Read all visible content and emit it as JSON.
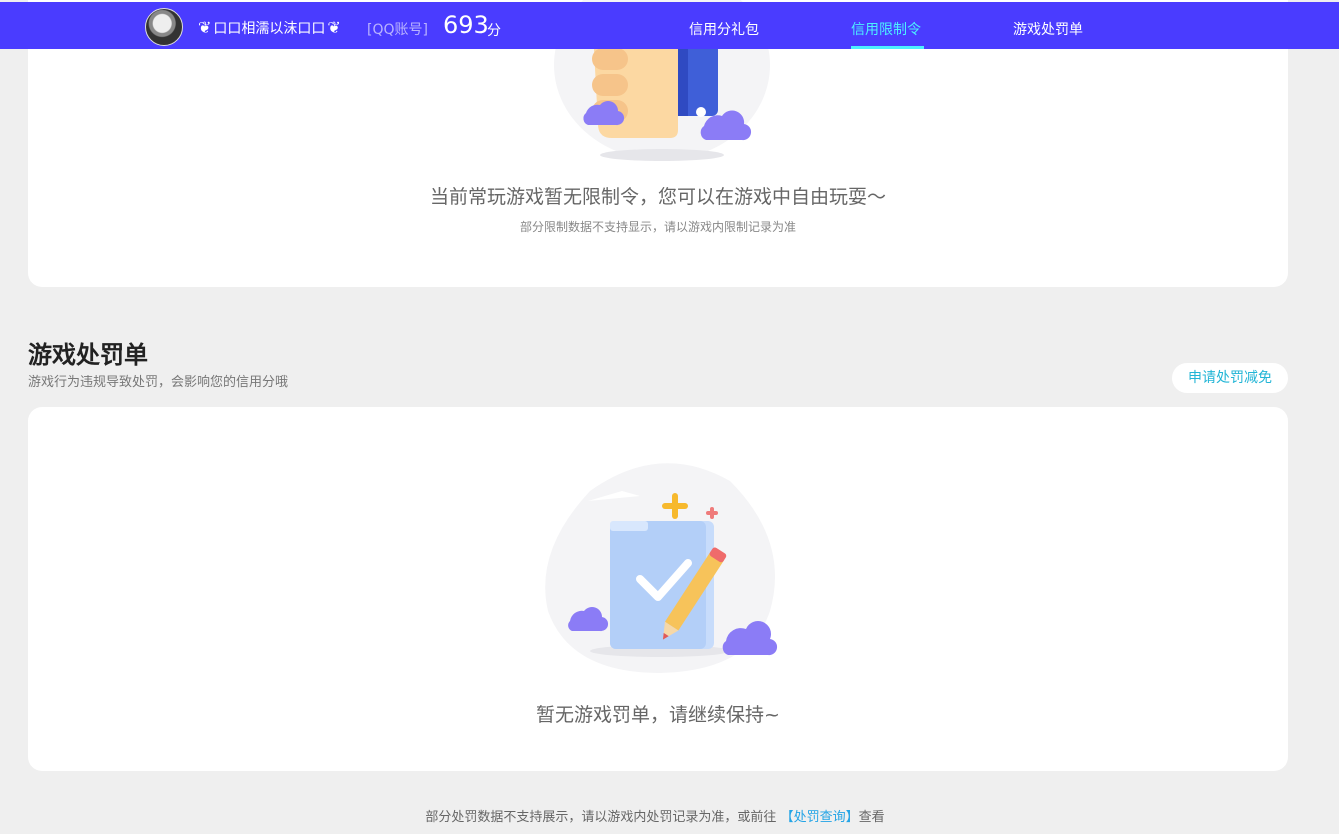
{
  "header": {
    "nickname": "口口相濡以沫口口",
    "nick_swirl_left": "ڿ",
    "nick_swirl_right": "ڿ",
    "account_tag": "[QQ账号]",
    "score": "693",
    "score_unit": "分",
    "nav": [
      {
        "label": "信用分礼包",
        "active": false
      },
      {
        "label": "信用限制令",
        "active": true
      },
      {
        "label": "游戏处罚单",
        "active": false
      }
    ]
  },
  "restriction_card": {
    "empty_text": "当前常玩游戏暂无限制令，您可以在游戏中自由玩耍～",
    "note": "部分限制数据不支持显示，请以游戏内限制记录为准"
  },
  "penalty_section": {
    "title": "游戏处罚单",
    "subtitle": "游戏行为违规导致处罚，会影响您的信用分哦",
    "appeal_button": "申请处罚减免",
    "empty_text": "暂无游戏罚单，请继续保持~"
  },
  "footer": {
    "note_prefix": "部分处罚数据不支持展示，请以游戏内处罚记录为准，或前往",
    "link_text": "【处罚查询】",
    "note_suffix": "查看"
  },
  "colors": {
    "header_bg": "#4a3cff",
    "active_nav": "#4cf0ff",
    "link": "#23a4e6",
    "page_bg": "#efefef"
  }
}
